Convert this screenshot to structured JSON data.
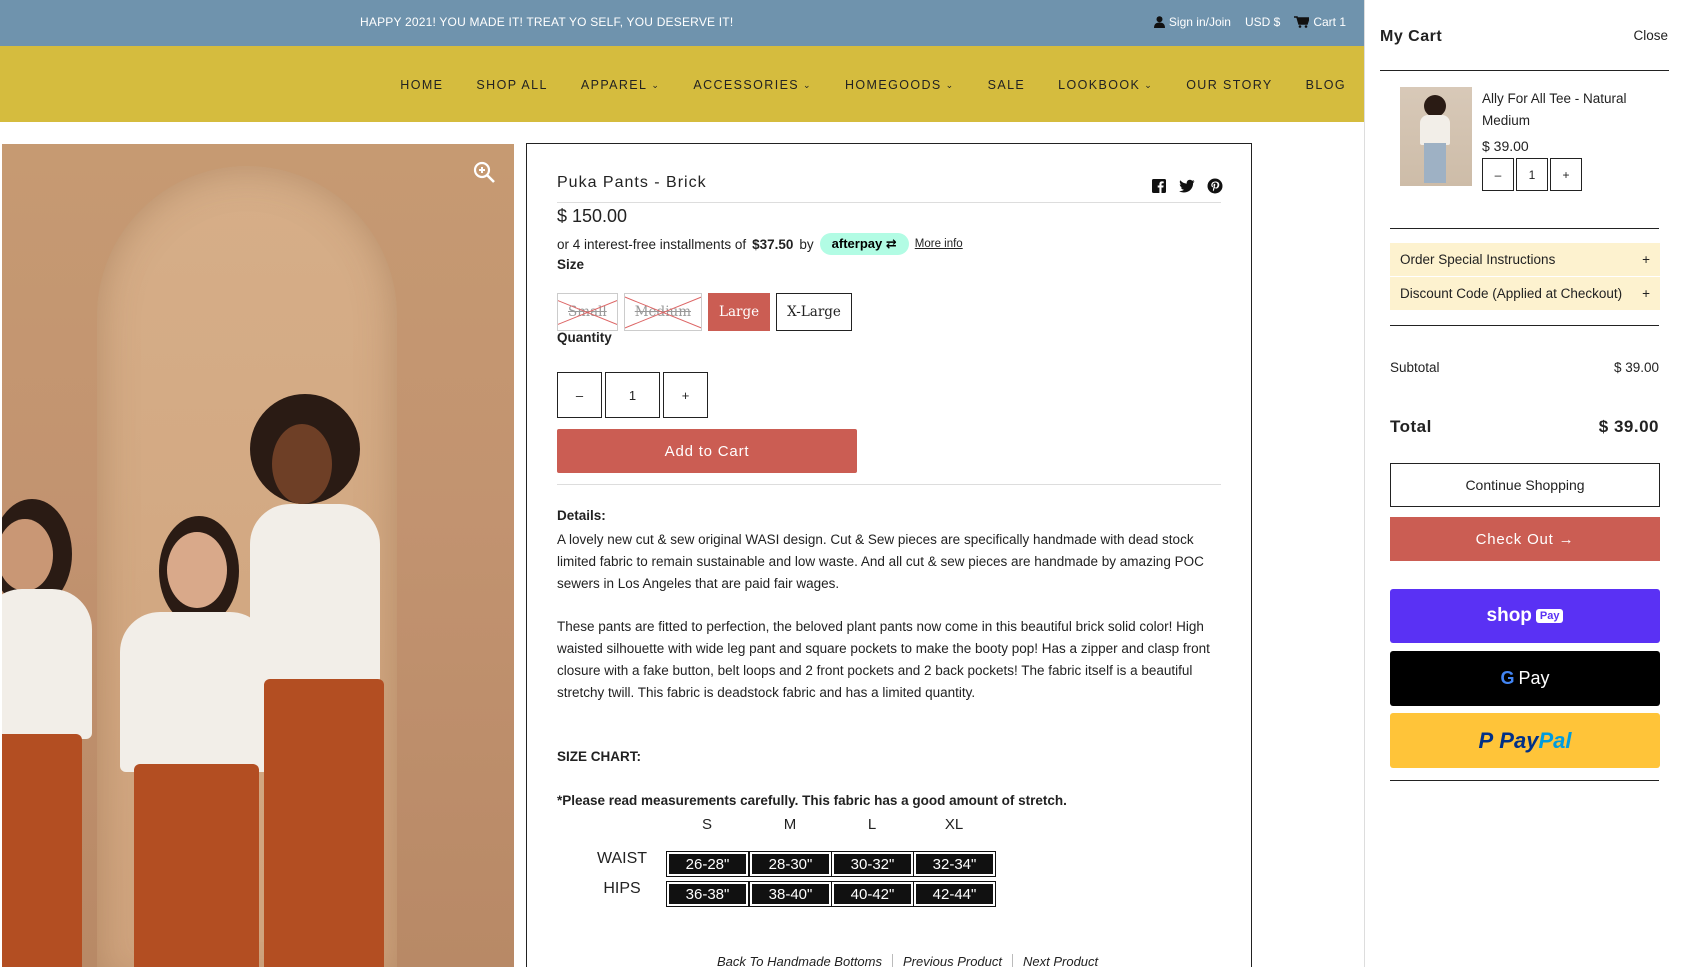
{
  "announcement": {
    "message": "HAPPY 2021! YOU MADE IT! TREAT YO SELF, YOU DESERVE IT!",
    "sign_in": "Sign in/Join",
    "currency": "USD $",
    "cart": "Cart 1"
  },
  "nav": {
    "items": [
      {
        "label": "HOME",
        "dropdown": false
      },
      {
        "label": "SHOP ALL",
        "dropdown": false
      },
      {
        "label": "APPAREL",
        "dropdown": true
      },
      {
        "label": "ACCESSORIES",
        "dropdown": true
      },
      {
        "label": "HOMEGOODS",
        "dropdown": true
      },
      {
        "label": "SALE",
        "dropdown": false
      },
      {
        "label": "LOOKBOOK",
        "dropdown": true
      },
      {
        "label": "OUR STORY",
        "dropdown": false
      },
      {
        "label": "BLOG",
        "dropdown": false
      }
    ]
  },
  "product": {
    "title": "Puka Pants - Brick",
    "price": "$ 150.00",
    "installments_prefix": "or 4 interest-free installments of",
    "installments_amount": "$37.50",
    "installments_by": "by",
    "afterpay_label": "afterpay",
    "more_info": "More info",
    "size_label": "Size",
    "sizes": [
      {
        "label": "Small",
        "state": "disabled"
      },
      {
        "label": "Medium",
        "state": "disabled"
      },
      {
        "label": "Large",
        "state": "selected"
      },
      {
        "label": "X-Large",
        "state": "available"
      }
    ],
    "quantity_label": "Quantity",
    "quantity": "1",
    "qty_minus": "–",
    "qty_plus": "+",
    "add_to_cart": "Add to Cart",
    "details_heading": "Details:",
    "details_p1": "A lovely new cut & sew original WASI design. Cut & Sew pieces are specifically handmade with dead stock limited fabric to remain sustainable and low waste. And all cut & sew pieces are handmade by amazing POC sewers in Los Angeles that are paid fair wages.",
    "details_p2": " These pants are fitted to perfection, the beloved plant pants now come in this beautiful brick solid color! High waisted silhouette with wide leg pant and square pockets to make the booty pop! Has a zipper and clasp front closure with a fake button, belt loops and 2 front pockets and 2 back pockets! The fabric itself is a beautiful stretchy twill. This fabric is deadstock fabric and has a limited quantity.",
    "size_chart_heading": "SIZE CHART:",
    "size_chart_note": "*Please read measurements carefully. This fabric has a good amount of stretch.",
    "size_chart": {
      "columns": [
        "S",
        "M",
        "L",
        "XL"
      ],
      "rows": [
        {
          "label": "WAIST",
          "values": [
            "26-28\"",
            "28-30\"",
            "30-32\"",
            "32-34\""
          ]
        },
        {
          "label": "HIPS",
          "values": [
            "36-38\"",
            "38-40\"",
            "40-42\"",
            "42-44\""
          ]
        }
      ]
    },
    "bottom_links": [
      "Back To Handmade Bottoms",
      "Previous Product",
      "Next Product"
    ]
  },
  "cart": {
    "title": "My Cart",
    "close": "Close",
    "item": {
      "name": "Ally For All Tee - Natural",
      "variant": "Medium",
      "price": "$ 39.00",
      "quantity": "1"
    },
    "special_instructions": "Order Special Instructions",
    "discount_code": "Discount Code (Applied at Checkout)",
    "expand_symbol": "+",
    "subtotal_label": "Subtotal",
    "subtotal_value": "$ 39.00",
    "total_label": "Total",
    "total_value": "$ 39.00",
    "continue_shopping": "Continue Shopping",
    "checkout": "Check Out →",
    "shop_pay": "shop",
    "shop_pay_badge": "Pay",
    "google_pay": "Pay",
    "paypal_1": "Pay",
    "paypal_2": "Pal"
  },
  "colors": {
    "announcement_bg": "#6f93ad",
    "nav_bg": "#d5bc3e",
    "accent": "#cb5d53",
    "accordion_bg": "#fdf2cf",
    "shop_pay": "#5a31f4",
    "paypal": "#ffc439"
  }
}
